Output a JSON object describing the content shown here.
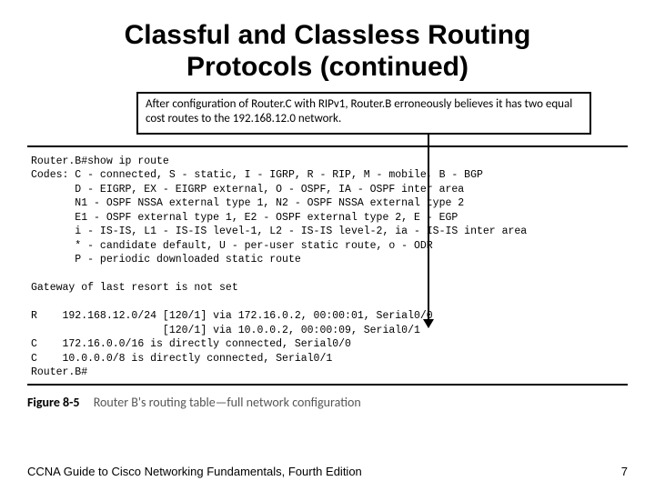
{
  "title": "Classful and Classless Routing Protocols (continued)",
  "callout": "After configuration of Router.C with RIPv1, Router.B erroneously believes it has two equal cost routes to the 192.168.12.0 network.",
  "terminal": "Router.B#show ip route\nCodes: C - connected, S - static, I - IGRP, R - RIP, M - mobile, B - BGP\n       D - EIGRP, EX - EIGRP external, O - OSPF, IA - OSPF inter area\n       N1 - OSPF NSSA external type 1, N2 - OSPF NSSA external type 2\n       E1 - OSPF external type 1, E2 - OSPF external type 2, E - EGP\n       i - IS-IS, L1 - IS-IS level-1, L2 - IS-IS level-2, ia - IS-IS inter area\n       * - candidate default, U - per-user static route, o - ODR\n       P - periodic downloaded static route\n\nGateway of last resort is not set\n\nR    192.168.12.0/24 [120/1] via 172.16.0.2, 00:00:01, Serial0/0\n                     [120/1] via 10.0.0.2, 00:00:09, Serial0/1\nC    172.16.0.0/16 is directly connected, Serial0/0\nC    10.0.0.0/8 is directly connected, Serial0/1\nRouter.B#",
  "figure": {
    "number": "Figure 8-5",
    "caption": "Router B's routing table—full network configuration"
  },
  "footer": {
    "left": "CCNA Guide to Cisco Networking Fundamentals, Fourth Edition",
    "right": "7"
  }
}
